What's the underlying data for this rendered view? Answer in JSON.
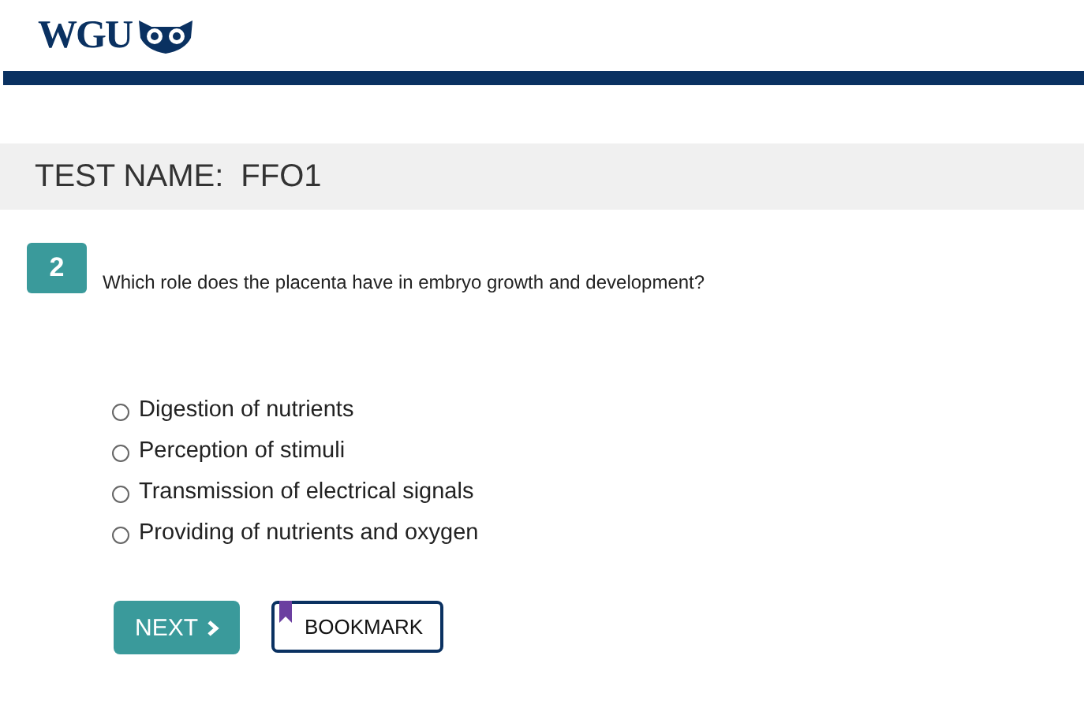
{
  "logo": {
    "text": "WGU"
  },
  "test": {
    "label": "TEST NAME:",
    "name": "FFO1"
  },
  "question": {
    "number": "2",
    "text": "Which role does the placenta have in embryo growth and development?"
  },
  "options": [
    {
      "label": "Digestion of nutrients",
      "selected": false
    },
    {
      "label": "Perception of stimuli",
      "selected": false
    },
    {
      "label": "Transmission of electrical signals",
      "selected": false
    },
    {
      "label": "Providing of nutrients and oxygen",
      "selected": false
    }
  ],
  "buttons": {
    "next": "NEXT",
    "bookmark": "BOOKMARK"
  }
}
